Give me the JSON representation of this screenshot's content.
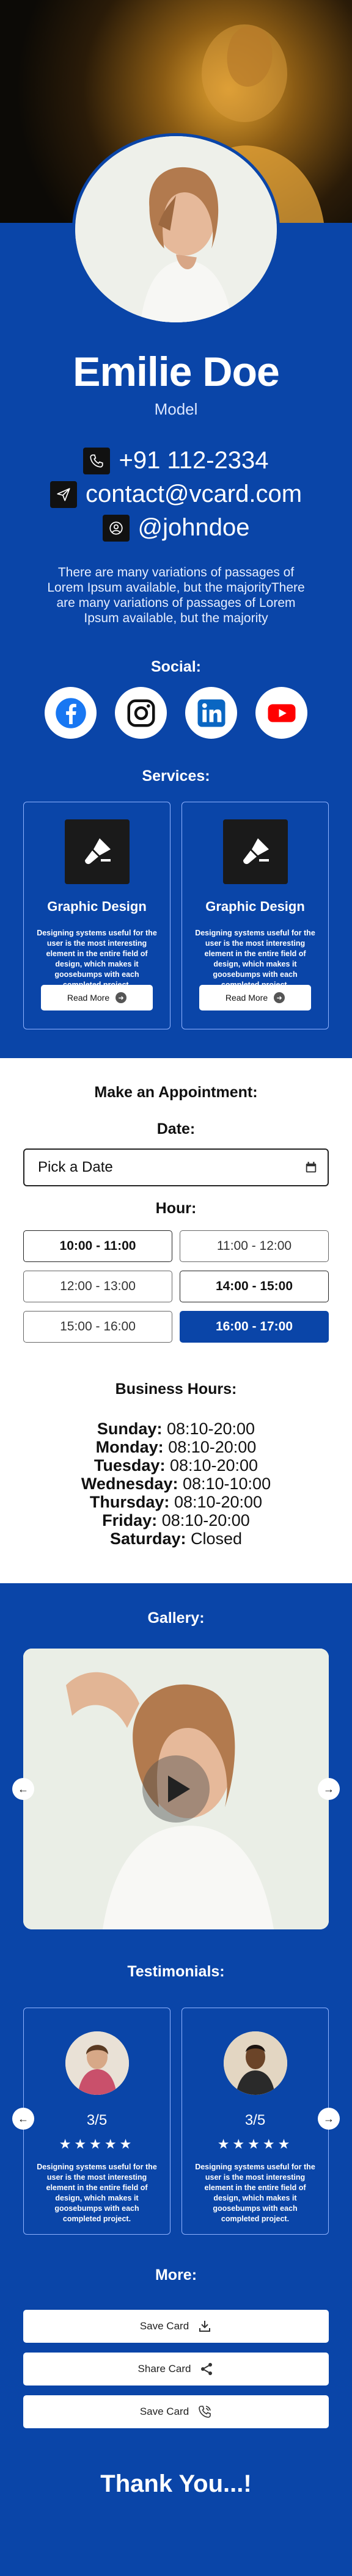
{
  "profile": {
    "name": "Emilie Doe",
    "role": "Model",
    "phone": "+91 112-2334",
    "email": "contact@vcard.com",
    "handle": "@johndoe",
    "intro": "There are many variations of passages of Lorem Ipsum available, but the majorityThere are many variations of passages of Lorem Ipsum available, but the majority"
  },
  "social": {
    "title": "Social:",
    "items": [
      "facebook-icon",
      "instagram-icon",
      "linkedin-icon",
      "youtube-icon"
    ]
  },
  "services": {
    "title": "Services:",
    "items": [
      {
        "title": "Graphic Design",
        "desc": "Designing systems useful for the user is the most interesting element in the entire field of design, which makes it goosebumps with each completed project.",
        "button": "Read More"
      },
      {
        "title": "Graphic Design",
        "desc": "Designing systems useful for the user is the most interesting element in the entire field of design, which makes it goosebumps with each completed project.",
        "button": "Read More"
      }
    ]
  },
  "appointment": {
    "title": "Make an Appointment:",
    "date_label": "Date:",
    "date_placeholder": "Pick a Date",
    "hour_label": "Hour:",
    "slots": [
      "10:00 - 11:00",
      "11:00 - 12:00",
      "12:00 - 13:00",
      "14:00 - 15:00",
      "15:00 - 16:00",
      "16:00 - 17:00"
    ]
  },
  "business_hours": {
    "title": "Business Hours:",
    "days": [
      {
        "day": "Sunday:",
        "time": "08:10-20:00"
      },
      {
        "day": "Monday:",
        "time": "08:10-20:00"
      },
      {
        "day": "Tuesday:",
        "time": "08:10-20:00"
      },
      {
        "day": "Wednesday:",
        "time": "08:10-10:00"
      },
      {
        "day": "Thursday:",
        "time": "08:10-20:00"
      },
      {
        "day": "Friday:",
        "time": "08:10-20:00"
      },
      {
        "day": "Saturday:",
        "time": "Closed"
      }
    ]
  },
  "gallery": {
    "title": "Gallery:"
  },
  "testimonials": {
    "title": "Testimonials:",
    "items": [
      {
        "score": "3/5",
        "stars": "★★★★★",
        "desc": "Designing systems useful for the user is the most interesting element in the entire field of design, which makes it goosebumps with each completed project."
      },
      {
        "score": "3/5",
        "stars": "★★★★★",
        "desc": "Designing systems useful for the user is the most interesting element in the entire field of design, which makes it goosebumps with each completed project."
      }
    ]
  },
  "more": {
    "title": "More:",
    "buttons": [
      "Save Card",
      "Share Card",
      "Save Card"
    ]
  },
  "footer": {
    "thanks": "Thank You...!"
  },
  "colors": {
    "primary": "#0a45a8",
    "white": "#ffffff",
    "dark": "#111111"
  }
}
